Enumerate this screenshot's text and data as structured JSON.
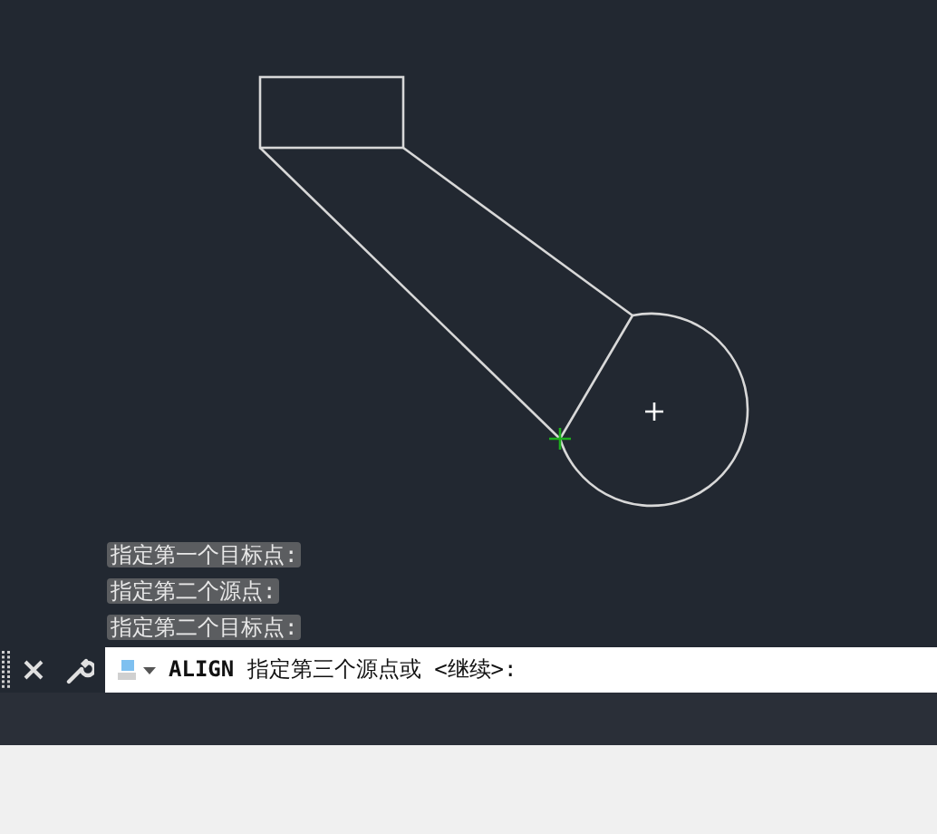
{
  "history": [
    {
      "text": "指定第一个目标点:"
    },
    {
      "text": "指定第二个源点:"
    },
    {
      "text": "指定第二个目标点:"
    }
  ],
  "command_line": {
    "command": "ALIGN",
    "prompt": "指定第三个源点或 <继续>:"
  }
}
